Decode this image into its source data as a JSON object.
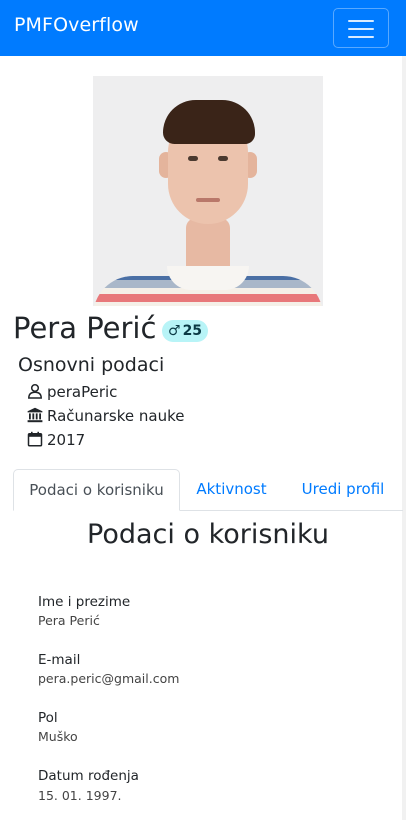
{
  "navbar": {
    "brand": "PMFOverflow",
    "color": "#007bff"
  },
  "profile": {
    "name": "Pera Perić",
    "badge": {
      "gender_symbol": "♂",
      "age": "25",
      "color": "#b8f4f7"
    },
    "section_title": "Osnovni podaci",
    "details": [
      {
        "icon": "user-icon",
        "text": "peraPeric"
      },
      {
        "icon": "university-icon",
        "text": "Računarske nauke"
      },
      {
        "icon": "calendar-icon",
        "text": "2017"
      }
    ]
  },
  "tabs": [
    {
      "label": "Podaci o korisniku",
      "active": true
    },
    {
      "label": "Aktivnost",
      "active": false
    },
    {
      "label": "Uredi profil",
      "active": false
    }
  ],
  "panel": {
    "title": "Podaci o korisniku",
    "fields": [
      {
        "label": "Ime i prezime",
        "value": "Pera Perić"
      },
      {
        "label": "E-mail",
        "value": "pera.peric@gmail.com"
      },
      {
        "label": "Pol",
        "value": "Muško"
      },
      {
        "label": "Datum rođenja",
        "value": "15. 01. 1997."
      }
    ]
  }
}
